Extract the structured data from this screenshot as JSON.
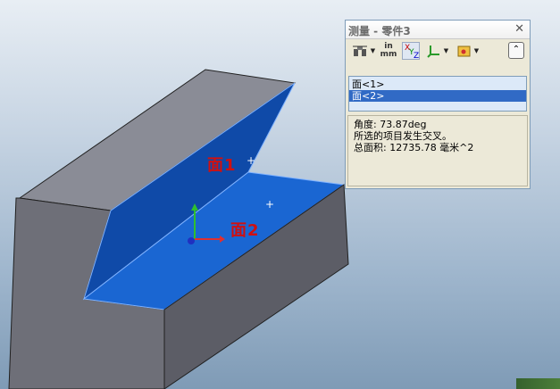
{
  "viewport": {
    "face1_label": "面1",
    "face2_label": "面2",
    "face1_marker": "+",
    "face2_marker": "+"
  },
  "measure_panel": {
    "title": "测量 - 零件3",
    "close_icon": "close-icon",
    "toolbar": {
      "units_top": "in",
      "units_bottom": "mm",
      "xyz_label": "XYZ"
    },
    "selections": [
      {
        "label": "面<1>",
        "selected": false
      },
      {
        "label": "面<2>",
        "selected": true
      }
    ],
    "results": [
      "角度: 73.87deg",
      "所选的项目发生交叉。",
      "总面积: 12735.78 毫米^2"
    ]
  },
  "colors": {
    "face_blue": "#1a66d2",
    "face_blue_dark": "#0d3f99",
    "body_gray": "#6e6f78",
    "selection_highlight": "#316ac5",
    "label_red": "#d01010"
  }
}
